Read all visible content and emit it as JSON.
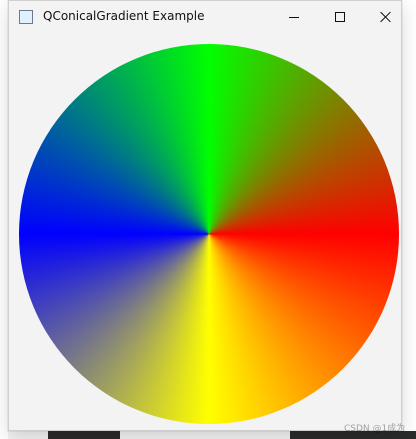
{
  "window": {
    "title": "QConicalGradient Example"
  },
  "overlay": {
    "watermark": "CSDN @1成为"
  }
}
